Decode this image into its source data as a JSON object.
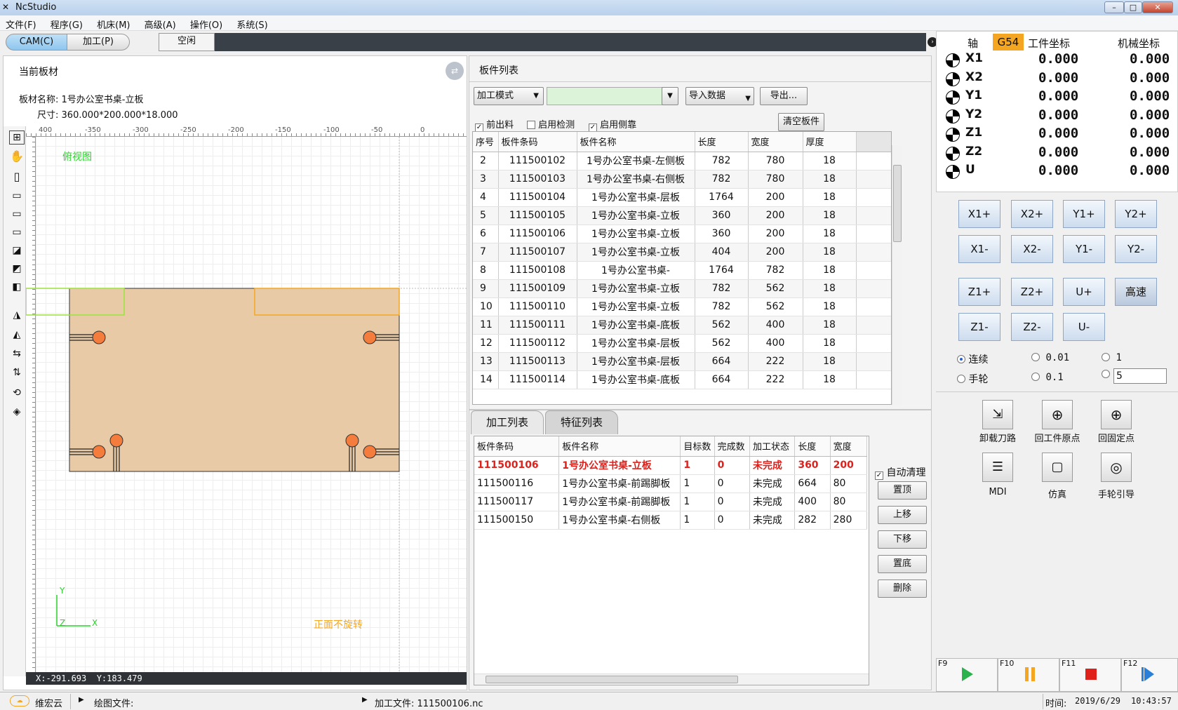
{
  "window": {
    "title": "NcStudio"
  },
  "menu": [
    "文件(F)",
    "程序(G)",
    "机床(M)",
    "高级(A)",
    "操作(O)",
    "系统(S)"
  ],
  "tabs": {
    "cam": "CAM(C)",
    "process": "加工(P)",
    "status": "空闲"
  },
  "current_board": {
    "title": "当前板材",
    "name_label": "板材名称:",
    "name_value": "1号办公室书桌-立板",
    "size_label": "尺寸:",
    "size_value": "360.000*200.000*18.000",
    "view_label": "俯视图",
    "rotate_label": "正面不旋转",
    "axis_y": "Y",
    "axis_z": "Z",
    "axis_x": "X",
    "cursor_x": "X:-291.693",
    "cursor_y": "Y:183.479",
    "ruler_ticks": [
      "400",
      "-350",
      "-300",
      "-250",
      "-200",
      "-150",
      "-100",
      "-50",
      "0"
    ]
  },
  "board_list": {
    "title": "板件列表",
    "mode_label": "加工模式",
    "import_label": "导入数据",
    "export_label": "导出...",
    "opt_front": "前出料",
    "opt_detect": "启用检测",
    "opt_side": "启用侧靠",
    "clear_label": "清空板件",
    "columns": [
      "序号",
      "板件条码",
      "板件名称",
      "长度",
      "宽度",
      "厚度"
    ],
    "rows": [
      [
        "2",
        "111500102",
        "1号办公室书桌-左侧板",
        "782",
        "780",
        "18"
      ],
      [
        "3",
        "111500103",
        "1号办公室书桌-右侧板",
        "782",
        "780",
        "18"
      ],
      [
        "4",
        "111500104",
        "1号办公室书桌-层板",
        "1764",
        "200",
        "18"
      ],
      [
        "5",
        "111500105",
        "1号办公室书桌-立板",
        "360",
        "200",
        "18"
      ],
      [
        "6",
        "111500106",
        "1号办公室书桌-立板",
        "360",
        "200",
        "18"
      ],
      [
        "7",
        "111500107",
        "1号办公室书桌-立板",
        "404",
        "200",
        "18"
      ],
      [
        "8",
        "111500108",
        "1号办公室书桌-",
        "1764",
        "782",
        "18"
      ],
      [
        "9",
        "111500109",
        "1号办公室书桌-立板",
        "782",
        "562",
        "18"
      ],
      [
        "10",
        "111500110",
        "1号办公室书桌-立板",
        "782",
        "562",
        "18"
      ],
      [
        "11",
        "111500111",
        "1号办公室书桌-底板",
        "562",
        "400",
        "18"
      ],
      [
        "12",
        "111500112",
        "1号办公室书桌-层板",
        "562",
        "400",
        "18"
      ],
      [
        "13",
        "111500113",
        "1号办公室书桌-层板",
        "664",
        "222",
        "18"
      ],
      [
        "14",
        "111500114",
        "1号办公室书桌-底板",
        "664",
        "222",
        "18"
      ]
    ]
  },
  "process_list": {
    "tab_process": "加工列表",
    "tab_feature": "特征列表",
    "columns": [
      "板件条码",
      "板件名称",
      "目标数",
      "完成数",
      "加工状态",
      "长度",
      "宽度"
    ],
    "rows": [
      [
        "111500106",
        "1号办公室书桌-立板",
        "1",
        "0",
        "未完成",
        "360",
        "200"
      ],
      [
        "111500116",
        "1号办公室书桌-前踢脚板",
        "1",
        "0",
        "未完成",
        "664",
        "80"
      ],
      [
        "111500117",
        "1号办公室书桌-前踢脚板",
        "1",
        "0",
        "未完成",
        "400",
        "80"
      ],
      [
        "111500150",
        "1号办公室书桌-右侧板",
        "1",
        "0",
        "未完成",
        "282",
        "280"
      ]
    ],
    "auto_clean": "自动清理",
    "actions": [
      "置顶",
      "上移",
      "下移",
      "置底",
      "删除"
    ]
  },
  "coords": {
    "axis_label": "轴",
    "g54": "G54",
    "work_label": "工件坐标",
    "machine_label": "机械坐标",
    "rows": [
      {
        "axis": "X1",
        "work": "0.000",
        "machine": "0.000"
      },
      {
        "axis": "X2",
        "work": "0.000",
        "machine": "0.000"
      },
      {
        "axis": "Y1",
        "work": "0.000",
        "machine": "0.000"
      },
      {
        "axis": "Y2",
        "work": "0.000",
        "machine": "0.000"
      },
      {
        "axis": "Z1",
        "work": "0.000",
        "machine": "0.000"
      },
      {
        "axis": "Z2",
        "work": "0.000",
        "machine": "0.000"
      },
      {
        "axis": "U",
        "work": "0.000",
        "machine": "0.000"
      }
    ]
  },
  "jog": {
    "row1": [
      "X1+",
      "X2+",
      "Y1+",
      "Y2+"
    ],
    "row2": [
      "X1-",
      "X2-",
      "Y1-",
      "Y2-"
    ],
    "row3": [
      "Z1+",
      "Z2+",
      "U+",
      "高速"
    ],
    "row4": [
      "Z1-",
      "Z2-",
      "U-"
    ],
    "mode_continuous": "连续",
    "mode_handwheel": "手轮",
    "step_001": "0.01",
    "step_01": "0.1",
    "step_1": "1",
    "step_custom": "5"
  },
  "functions": {
    "unload": "卸载刀路",
    "work_origin": "回工件原点",
    "fixed_point": "回固定点",
    "mdi": "MDI",
    "sim": "仿真",
    "handwheel": "手轮引导"
  },
  "fkeys": [
    "F9",
    "F10",
    "F11",
    "F12"
  ],
  "statusbar": {
    "cloud": "维宏云",
    "draw_file": "绘图文件:",
    "process_file": "加工文件: 111500106.nc",
    "time_label": "时间:",
    "date": "2019/6/29",
    "time": "10:43:57"
  },
  "colors": {
    "accent": "#f4a623",
    "highlight_red": "#e0201b",
    "board_fill": "#e8cba6",
    "hole": "#f47c3c",
    "ok_green": "#2bb24c"
  }
}
